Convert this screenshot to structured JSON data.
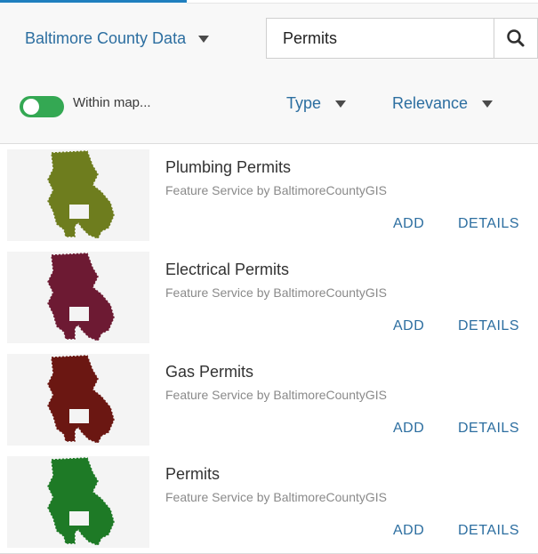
{
  "search": {
    "source_label": "Baltimore County Data",
    "query": "Permits",
    "placeholder": ""
  },
  "filters": {
    "within_map_label": "Within map...",
    "within_map_on": true,
    "type_label": "Type",
    "sort_label": "Relevance"
  },
  "results": [
    {
      "title": "Plumbing Permits",
      "subtitle": "Feature Service by BaltimoreCountyGIS",
      "add_label": "ADD",
      "details_label": "DETAILS",
      "thumb_color": "#6e7d1e"
    },
    {
      "title": "Electrical Permits",
      "subtitle": "Feature Service by BaltimoreCountyGIS",
      "add_label": "ADD",
      "details_label": "DETAILS",
      "thumb_color": "#6d1a33"
    },
    {
      "title": "Gas Permits",
      "subtitle": "Feature Service by BaltimoreCountyGIS",
      "add_label": "ADD",
      "details_label": "DETAILS",
      "thumb_color": "#6b1712"
    },
    {
      "title": "Permits",
      "subtitle": "Feature Service by BaltimoreCountyGIS",
      "add_label": "ADD",
      "details_label": "DETAILS",
      "thumb_color": "#1e7a26"
    }
  ],
  "colors": {
    "accent": "#1f7fbf",
    "link": "#2c6ea0",
    "toggle_on": "#34a853"
  }
}
